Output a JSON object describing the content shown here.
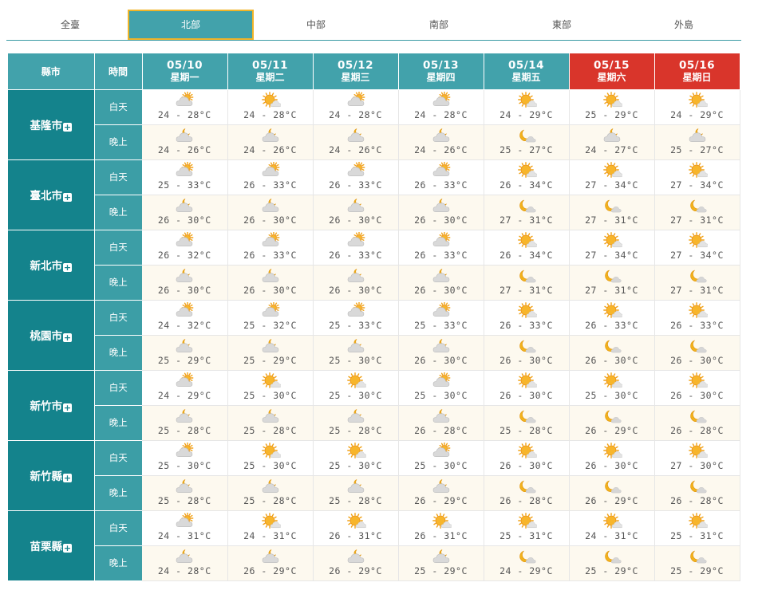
{
  "tabs": [
    {
      "label": "全臺",
      "active": false
    },
    {
      "label": "北部",
      "active": true
    },
    {
      "label": "中部",
      "active": false
    },
    {
      "label": "南部",
      "active": false
    },
    {
      "label": "東部",
      "active": false
    },
    {
      "label": "外島",
      "active": false
    }
  ],
  "header": {
    "county_label": "縣市",
    "time_label": "時間",
    "days": [
      {
        "date": "05/10",
        "weekday": "星期一",
        "weekend": false
      },
      {
        "date": "05/11",
        "weekday": "星期二",
        "weekend": false
      },
      {
        "date": "05/12",
        "weekday": "星期三",
        "weekend": false
      },
      {
        "date": "05/13",
        "weekday": "星期四",
        "weekend": false
      },
      {
        "date": "05/14",
        "weekday": "星期五",
        "weekend": false
      },
      {
        "date": "05/15",
        "weekday": "星期六",
        "weekend": true
      },
      {
        "date": "05/16",
        "weekday": "星期日",
        "weekend": true
      }
    ]
  },
  "period_labels": {
    "day": "白天",
    "night": "晚上"
  },
  "expand_symbol": "+",
  "temp_sep": " - ",
  "temp_unit": "°C",
  "cities": [
    {
      "name": "基隆市",
      "day": [
        [
          "cloudy-sun",
          24,
          28
        ],
        [
          "sunny",
          24,
          28
        ],
        [
          "cloudy-sun",
          24,
          28
        ],
        [
          "cloudy-sun",
          24,
          28
        ],
        [
          "sunny",
          24,
          29
        ],
        [
          "sunny",
          25,
          29
        ],
        [
          "sunny",
          24,
          29
        ]
      ],
      "night": [
        [
          "cloudy-moon",
          24,
          26
        ],
        [
          "cloudy-moon",
          24,
          26
        ],
        [
          "cloudy-moon",
          24,
          26
        ],
        [
          "cloudy-moon",
          24,
          26
        ],
        [
          "moon",
          25,
          27
        ],
        [
          "cloudy-moon",
          24,
          27
        ],
        [
          "cloudy-moon",
          25,
          27
        ]
      ]
    },
    {
      "name": "臺北市",
      "day": [
        [
          "cloudy-sun",
          25,
          33
        ],
        [
          "cloudy-sun",
          26,
          33
        ],
        [
          "cloudy-sun",
          26,
          33
        ],
        [
          "cloudy-sun",
          26,
          33
        ],
        [
          "sunny",
          26,
          34
        ],
        [
          "sunny",
          27,
          34
        ],
        [
          "sunny",
          27,
          34
        ]
      ],
      "night": [
        [
          "cloudy-moon",
          26,
          30
        ],
        [
          "cloudy-moon",
          26,
          30
        ],
        [
          "cloudy-moon",
          26,
          30
        ],
        [
          "cloudy-moon",
          26,
          30
        ],
        [
          "moon",
          27,
          31
        ],
        [
          "moon",
          27,
          31
        ],
        [
          "moon",
          27,
          31
        ]
      ]
    },
    {
      "name": "新北市",
      "day": [
        [
          "cloudy-sun",
          26,
          32
        ],
        [
          "cloudy-sun",
          26,
          33
        ],
        [
          "cloudy-sun",
          26,
          33
        ],
        [
          "cloudy-sun",
          26,
          33
        ],
        [
          "sunny",
          26,
          34
        ],
        [
          "sunny",
          27,
          34
        ],
        [
          "sunny",
          27,
          34
        ]
      ],
      "night": [
        [
          "cloudy-moon",
          26,
          30
        ],
        [
          "cloudy-moon",
          26,
          30
        ],
        [
          "cloudy-moon",
          26,
          30
        ],
        [
          "cloudy-moon",
          26,
          30
        ],
        [
          "moon",
          27,
          31
        ],
        [
          "moon",
          27,
          31
        ],
        [
          "moon",
          27,
          31
        ]
      ]
    },
    {
      "name": "桃園市",
      "day": [
        [
          "cloudy-sun",
          24,
          32
        ],
        [
          "cloudy-sun",
          25,
          32
        ],
        [
          "cloudy-sun",
          25,
          33
        ],
        [
          "cloudy-sun",
          25,
          33
        ],
        [
          "sunny",
          26,
          33
        ],
        [
          "sunny",
          26,
          33
        ],
        [
          "sunny",
          26,
          33
        ]
      ],
      "night": [
        [
          "cloudy-moon",
          25,
          29
        ],
        [
          "cloudy-moon",
          25,
          29
        ],
        [
          "cloudy-moon",
          25,
          30
        ],
        [
          "cloudy-moon",
          26,
          30
        ],
        [
          "moon",
          26,
          30
        ],
        [
          "moon",
          26,
          30
        ],
        [
          "moon",
          26,
          30
        ]
      ]
    },
    {
      "name": "新竹市",
      "day": [
        [
          "cloudy-sun",
          24,
          29
        ],
        [
          "sunny",
          25,
          30
        ],
        [
          "sunny",
          25,
          30
        ],
        [
          "cloudy-sun",
          25,
          30
        ],
        [
          "sunny",
          26,
          30
        ],
        [
          "sunny",
          25,
          30
        ],
        [
          "sunny",
          26,
          30
        ]
      ],
      "night": [
        [
          "cloudy-moon",
          25,
          28
        ],
        [
          "cloudy-moon",
          25,
          28
        ],
        [
          "cloudy-moon",
          25,
          28
        ],
        [
          "cloudy-moon",
          26,
          28
        ],
        [
          "moon",
          25,
          28
        ],
        [
          "moon",
          26,
          29
        ],
        [
          "moon",
          26,
          28
        ]
      ]
    },
    {
      "name": "新竹縣",
      "day": [
        [
          "cloudy-sun",
          25,
          30
        ],
        [
          "sunny",
          25,
          30
        ],
        [
          "sunny",
          25,
          30
        ],
        [
          "cloudy-sun",
          25,
          30
        ],
        [
          "sunny",
          26,
          30
        ],
        [
          "sunny",
          26,
          30
        ],
        [
          "sunny",
          27,
          30
        ]
      ],
      "night": [
        [
          "cloudy-moon",
          25,
          28
        ],
        [
          "cloudy-moon",
          25,
          28
        ],
        [
          "cloudy-moon",
          25,
          28
        ],
        [
          "cloudy-moon",
          26,
          29
        ],
        [
          "moon",
          26,
          28
        ],
        [
          "moon",
          26,
          29
        ],
        [
          "moon",
          26,
          28
        ]
      ]
    },
    {
      "name": "苗栗縣",
      "day": [
        [
          "cloudy-sun",
          24,
          31
        ],
        [
          "sunny",
          24,
          31
        ],
        [
          "sunny",
          26,
          31
        ],
        [
          "sunny",
          26,
          31
        ],
        [
          "sunny",
          25,
          31
        ],
        [
          "sunny",
          24,
          31
        ],
        [
          "sunny",
          25,
          31
        ]
      ],
      "night": [
        [
          "cloudy-moon",
          24,
          28
        ],
        [
          "cloudy-moon",
          26,
          29
        ],
        [
          "cloudy-moon",
          26,
          29
        ],
        [
          "cloudy-moon",
          25,
          29
        ],
        [
          "moon",
          24,
          29
        ],
        [
          "moon",
          25,
          29
        ],
        [
          "moon",
          25,
          29
        ]
      ]
    }
  ]
}
